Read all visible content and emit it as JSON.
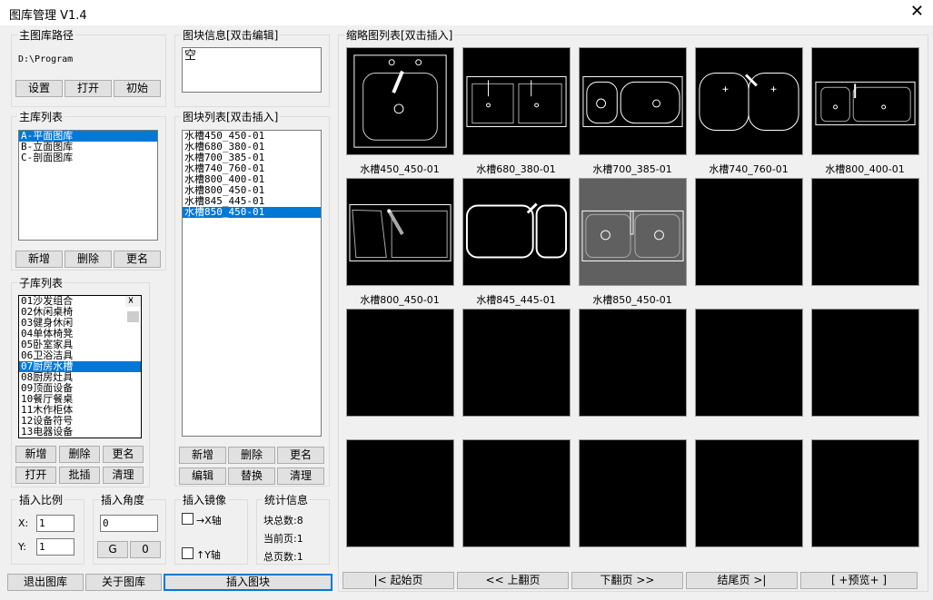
{
  "window": {
    "title": "图库管理 V1.4",
    "close": "✕"
  },
  "path_group": {
    "label": "主图库路径",
    "path": "D:\\Program",
    "buttons": [
      "设置",
      "打开",
      "初始"
    ]
  },
  "info_group": {
    "label": "图块信息[双击编辑]",
    "value": "空"
  },
  "main_lib": {
    "label": "主库列表",
    "items": [
      "A-平面图库",
      "B-立面图库",
      "C-剖面图库"
    ],
    "selected": 0,
    "buttons": [
      "新增",
      "删除",
      "更名"
    ]
  },
  "block_list": {
    "label": "图块列表[双击插入]",
    "items": [
      "水槽450_450-01",
      "水槽680_380-01",
      "水槽700_385-01",
      "水槽740_760-01",
      "水槽800_400-01",
      "水槽800_450-01",
      "水槽845_445-01",
      "水槽850_450-01"
    ],
    "selected": 7,
    "buttons": [
      "新增",
      "删除",
      "更名",
      "编辑",
      "替换",
      "清理"
    ]
  },
  "sub_lib": {
    "label": "子库列表",
    "items": [
      "01沙发组合",
      "02休闲桌椅",
      "03健身休闲",
      "04单体椅凳",
      "05卧室家具",
      "06卫浴洁具",
      "07厨房水槽",
      "08厨房灶具",
      "09顶面设备",
      "10餐厅餐桌",
      "11木作柜体",
      "12设备符号",
      "13电器设备"
    ],
    "selected": 6,
    "buttons": [
      "新增",
      "删除",
      "更名",
      "打开",
      "批插",
      "清理"
    ],
    "scroll_up": "˄",
    "scroll_down": "˅"
  },
  "scale": {
    "label": "插入比例",
    "x_label": "X:",
    "x": "1",
    "y_label": "Y:",
    "y": "1"
  },
  "angle": {
    "label": "插入角度",
    "value": "0",
    "buttons": [
      "G",
      "0"
    ]
  },
  "mirror": {
    "label": "插入镜像",
    "x": "→X轴",
    "y": "↑Y轴"
  },
  "stats": {
    "label": "统计信息",
    "total": "块总数:8",
    "page": "当前页:1",
    "pages": "总页数:1"
  },
  "bottom": {
    "exit": "退出图库",
    "about": "关于图库",
    "insert": "插入图块"
  },
  "thumbs": {
    "label": "缩略图列表[双击插入]",
    "items": [
      "水槽450_450-01",
      "水槽680_380-01",
      "水槽700_385-01",
      "水槽740_760-01",
      "水槽800_400-01",
      "水槽800_450-01",
      "水槽845_445-01",
      "水槽850_450-01"
    ],
    "selected": 7
  },
  "nav": [
    "|< 起始页",
    "<< 上翻页",
    "下翻页 >>",
    "结尾页 >|",
    "[ +预览+ ]"
  ]
}
